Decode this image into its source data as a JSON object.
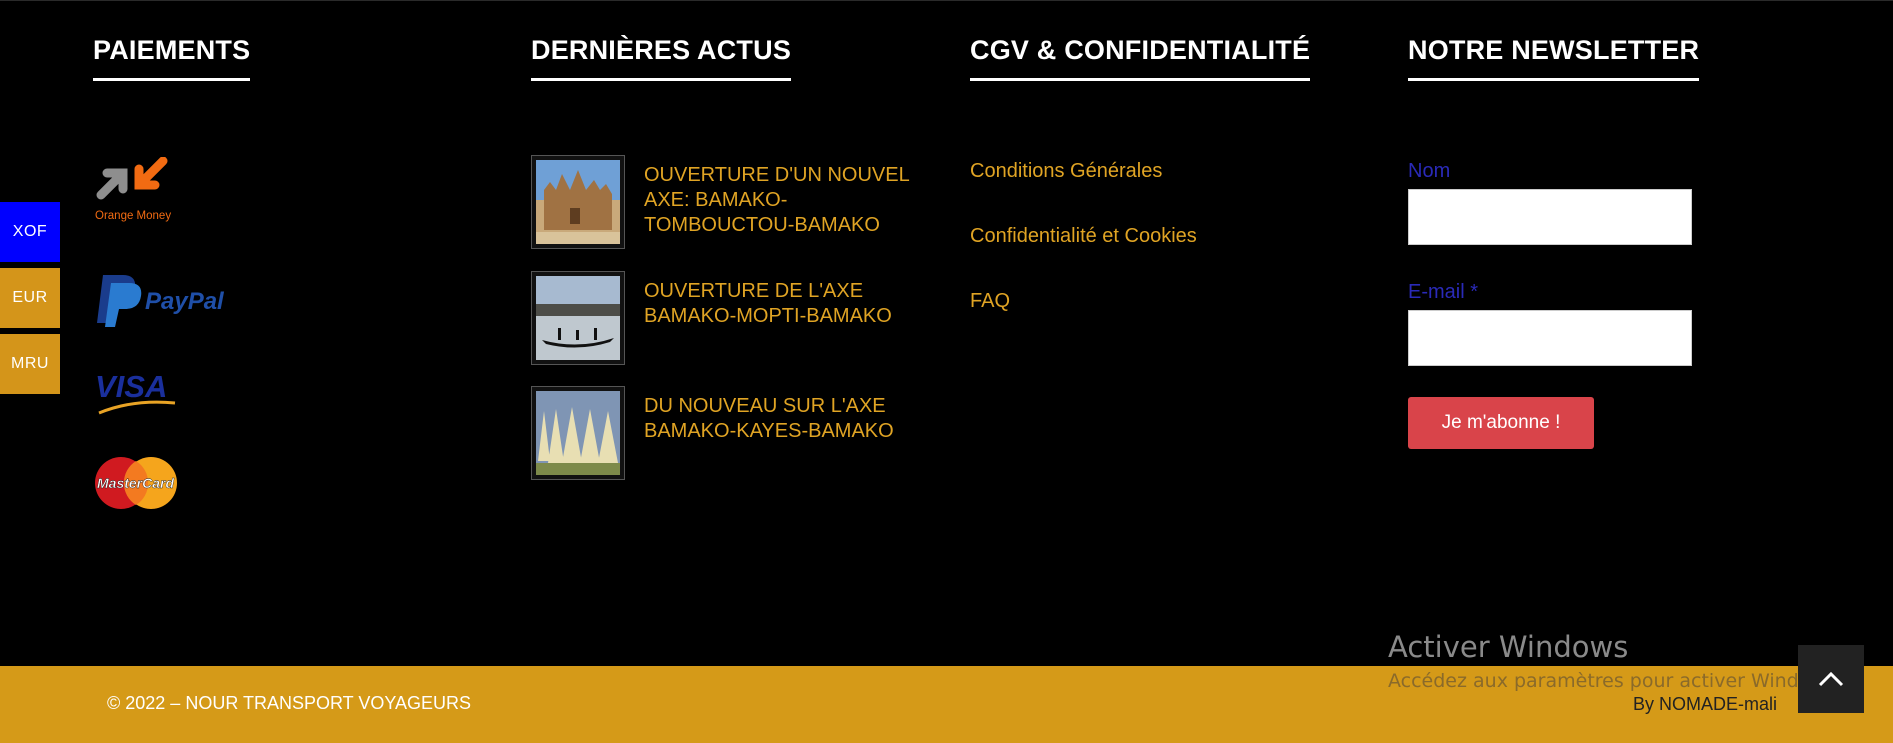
{
  "currency_switcher": {
    "items": [
      {
        "code": "XOF",
        "color": "#0000ff"
      },
      {
        "code": "EUR",
        "color": "#d4951a"
      },
      {
        "code": "MRU",
        "color": "#d4951a"
      }
    ]
  },
  "payments": {
    "title": "PAIEMENTS",
    "logos": [
      "orange-money-logo",
      "paypal-logo",
      "visa-logo",
      "mastercard-logo"
    ],
    "orange_money_text": "Orange Money",
    "paypal_text": "PayPal",
    "visa_text": "VISA",
    "mastercard_text": "MasterCard"
  },
  "news": {
    "title": "DERNIÈRES ACTUS",
    "items": [
      {
        "title": "OUVERTURE D'UN NOUVEL AXE: BAMAKO-TOMBOUCTOU-BAMAKO",
        "thumb": "mosque-thumbnail"
      },
      {
        "title": "OUVERTURE DE L'AXE BAMAKO-MOPTI-BAMAKO",
        "thumb": "river-boat-thumbnail"
      },
      {
        "title": "DU NOUVEAU SUR L'AXE BAMAKO-KAYES-BAMAKO",
        "thumb": "monument-thumbnail"
      }
    ]
  },
  "cgv": {
    "title": "CGV & CONFIDENTIALITÉ",
    "links": [
      "Conditions Générales",
      "Confidentialité et Cookies",
      "FAQ"
    ]
  },
  "newsletter": {
    "title": "NOTRE NEWSLETTER",
    "name_label": "Nom",
    "email_label": "E-mail *",
    "name_value": "",
    "email_value": "",
    "button_label": "Je m'abonne !"
  },
  "watermark": {
    "title": "Activer Windows",
    "subtitle": "Accédez aux paramètres pour activer Windows."
  },
  "footer_bar": {
    "copyright": "© 2022 – NOUR TRANSPORT VOYAGEURS",
    "credit": "By NOMADE-mali",
    "background": "#d59a18"
  },
  "back_to_top": {
    "icon": "chevron-up-icon"
  },
  "colors": {
    "link": "#e0a424",
    "label": "#2a2ab8",
    "button": "#d9444a"
  }
}
